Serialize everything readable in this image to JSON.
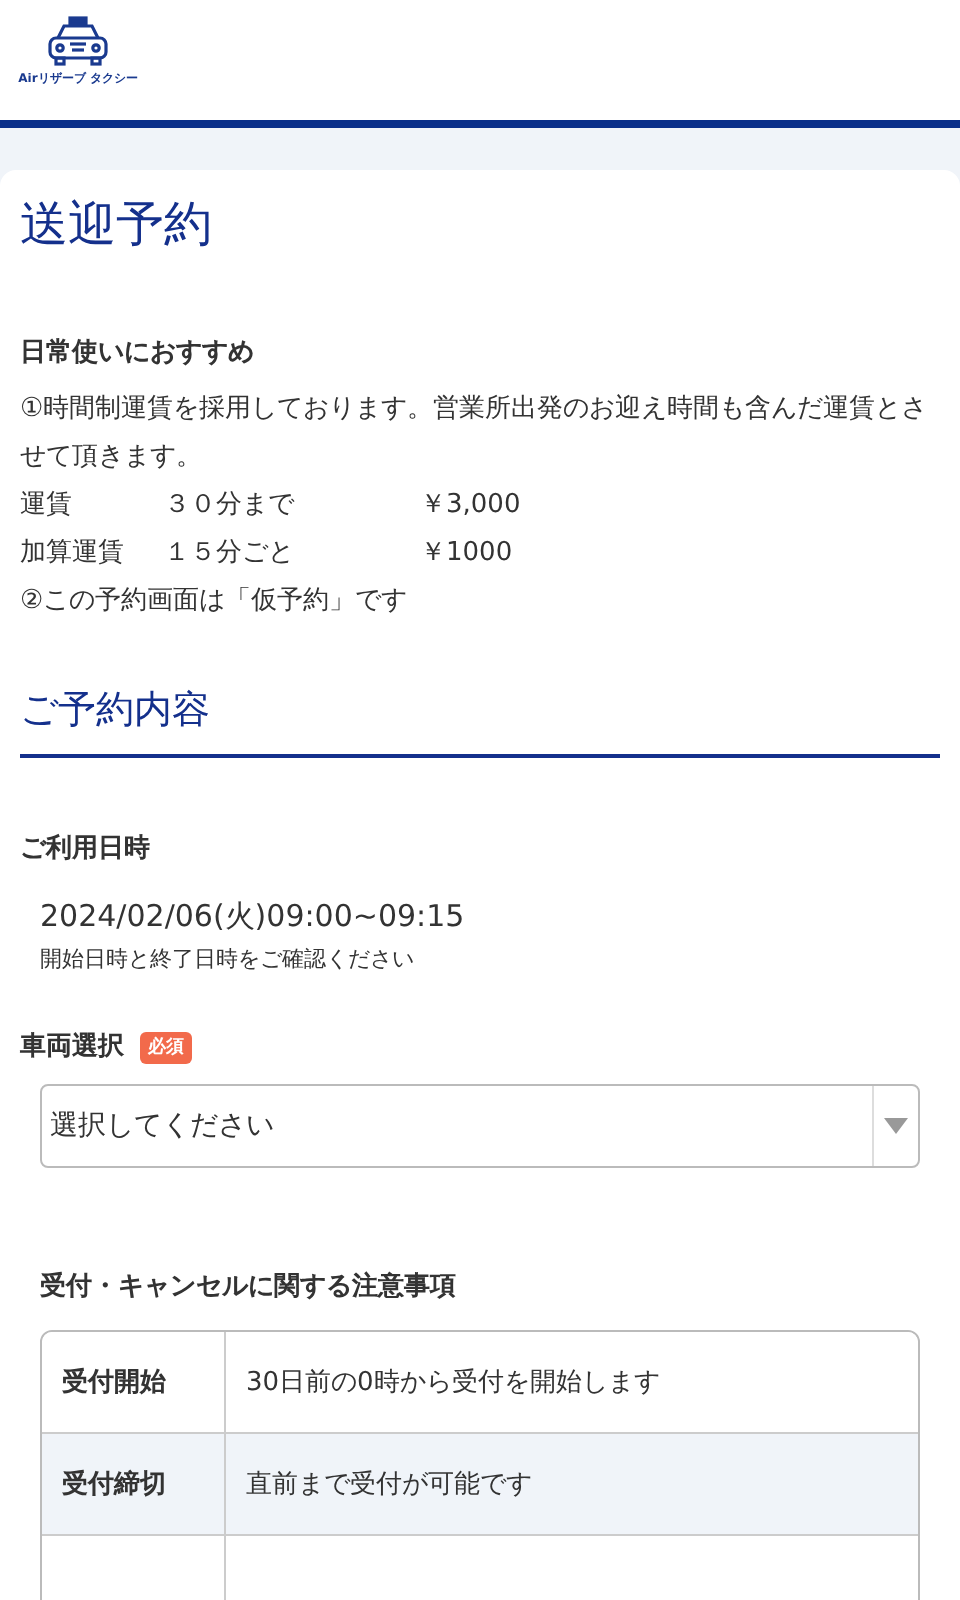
{
  "logo": {
    "text": "Airリザーブ タクシー"
  },
  "page_title": "送迎予約",
  "intro": {
    "heading": "日常使いにおすすめ",
    "lines": [
      {
        "kind": "text",
        "text": "①時間制運賃を採用しております。営業所出発のお迎え時間も含んだ運賃とさせて頂きます。"
      },
      {
        "kind": "fare",
        "label": "運賃",
        "unit": "３０分まで",
        "price": "￥3,000"
      },
      {
        "kind": "fare",
        "label": "加算運賃",
        "unit": "１５分ごと",
        "price": "￥1000"
      },
      {
        "kind": "text",
        "text": "②この予約画面は「仮予約」です"
      }
    ]
  },
  "section_title": "ご予約内容",
  "datetime": {
    "label": "ご利用日時",
    "value": "2024/02/06(火)09:00~09:15",
    "note": "開始日時と終了日時をご確認ください"
  },
  "vehicle": {
    "label": "車両選択",
    "badge": "必須",
    "placeholder": "選択してください"
  },
  "notice": {
    "title": "受付・キャンセルに関する注意事項",
    "rows": [
      {
        "label": "受付開始",
        "value": "30日前の0時から受付を開始します",
        "shaded": false
      },
      {
        "label": "受付締切",
        "value": "直前まで受付が可能です",
        "shaded": true
      }
    ]
  }
}
